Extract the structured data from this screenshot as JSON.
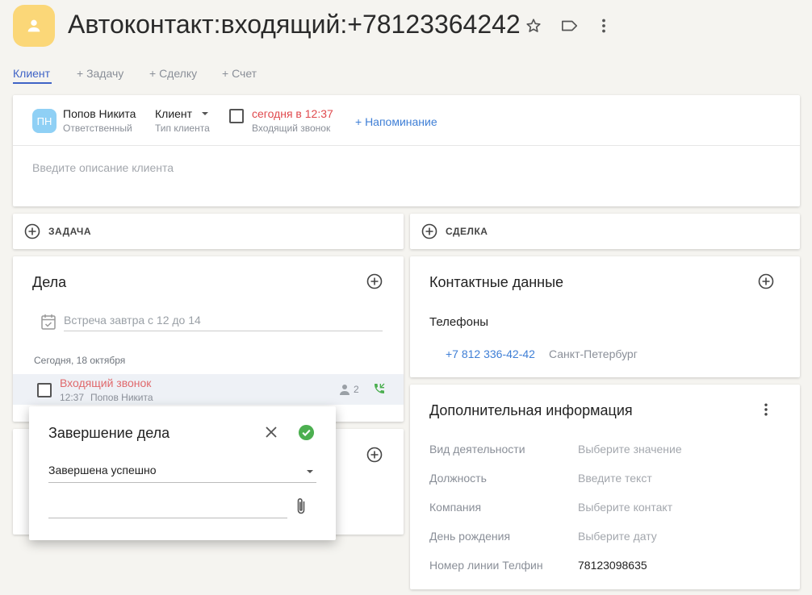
{
  "header": {
    "title": "Автоконтакт:входящий:+78123364242"
  },
  "tabs": [
    {
      "label": "Клиент"
    },
    {
      "label": "+ Задачу"
    },
    {
      "label": "+ Сделку"
    },
    {
      "label": "+ Счет"
    }
  ],
  "client_card": {
    "owner_initials": "ПН",
    "owner_name": "Попов Никита",
    "owner_role": "Ответственный",
    "client_type": "Клиент",
    "client_type_label": "Тип клиента",
    "due_time": "сегодня в 12:37",
    "due_event": "Входящий звонок",
    "reminder_link": "+ Напоминание",
    "description_placeholder": "Введите описание клиента"
  },
  "quick_add": {
    "task_label": "ЗАДАЧА",
    "deal_label": "СДЕЛКА"
  },
  "tasks": {
    "title": "Дела",
    "new_task_placeholder": "Встреча завтра с 12 до 14",
    "date_group": "Сегодня, 18 октября",
    "item": {
      "title": "Входящий звонок",
      "time": "12:37",
      "owner": "Попов Никита",
      "participants": "2"
    }
  },
  "contacts": {
    "title": "Контактные данные",
    "phones_label": "Телефоны",
    "phone": "+7 812 336-42-42",
    "city": "Санкт-Петербург"
  },
  "extra": {
    "title": "Дополнительная информация",
    "rows": [
      {
        "label": "Вид деятельности",
        "value": "Выберите значение",
        "filled": false
      },
      {
        "label": "Должность",
        "value": "Введите текст",
        "filled": false
      },
      {
        "label": "Компания",
        "value": "Выберите контакт",
        "filled": false
      },
      {
        "label": "День рождения",
        "value": "Выберите дату",
        "filled": false
      },
      {
        "label": "Номер линии Телфин",
        "value": "78123098635",
        "filled": true
      }
    ]
  },
  "complete_dialog": {
    "title": "Завершение дела",
    "result": "Завершена успешно",
    "comment_value": ""
  },
  "colors": {
    "avatar_bg": "#fbd778",
    "accent": "#3f7fd6",
    "danger": "#e0494d",
    "success": "#4caf50"
  }
}
